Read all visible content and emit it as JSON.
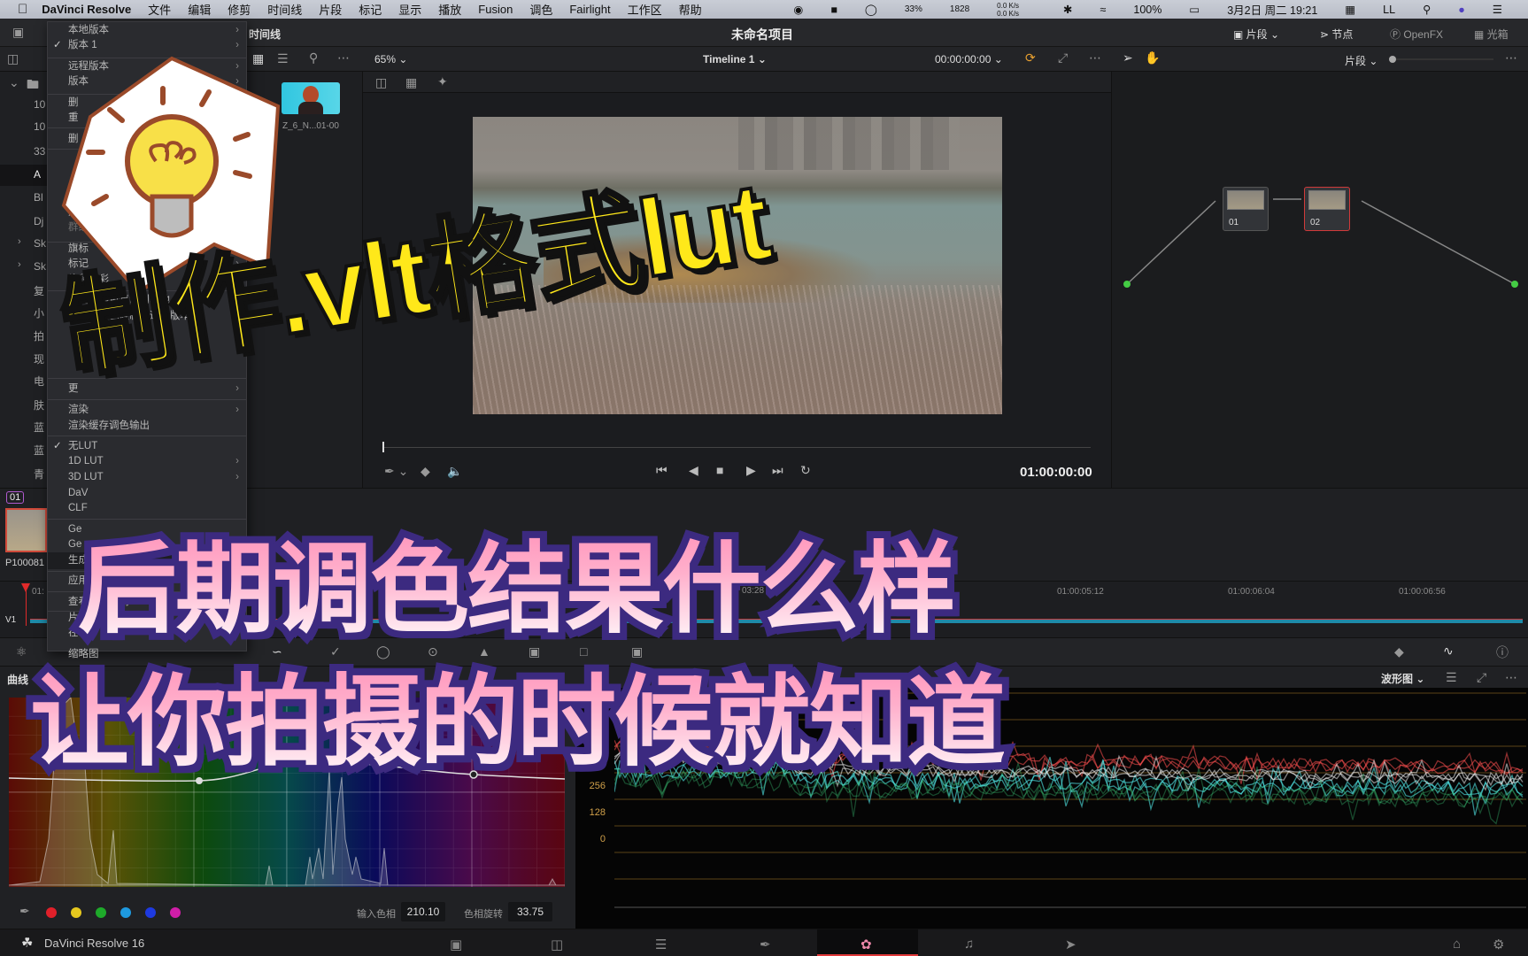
{
  "macbar": {
    "app": "DaVinci Resolve",
    "menus": [
      "文件",
      "编辑",
      "修剪",
      "时间线",
      "片段",
      "标记",
      "显示",
      "播放",
      "Fusion",
      "调色",
      "Fairlight",
      "工作区",
      "帮助"
    ],
    "status": {
      "cpu": "33%",
      "rpm": "1828",
      "net_up": "0.0 K/s",
      "net_down": "0.0 K/s",
      "battery": "100%",
      "datetime": "3月2日 周二 19:21",
      "user": "LL"
    }
  },
  "titlebar": {
    "project_title": "未命名项目",
    "left_label": "时间线",
    "buttons": [
      "片段",
      "节点",
      "OpenFX",
      "光箱"
    ]
  },
  "toolbar": {
    "zoom": "65%",
    "timeline": "Timeline 1",
    "timecode": "00:00:00:00",
    "node_mode": "片段"
  },
  "media_pool": {
    "bins": [
      "10",
      "10",
      "33",
      "A",
      "Bl",
      "Dj",
      "Sk",
      "Sk",
      "复",
      "小",
      "拍",
      "现",
      "电",
      "肤",
      "蓝",
      "蓝",
      "青"
    ],
    "selected_index": 3
  },
  "gallery": {
    "still_label": "Z_6_N...01-00"
  },
  "context_menu": {
    "items": [
      {
        "label": "本地版本",
        "submenu": true
      },
      {
        "label": "版本 1",
        "checked": true,
        "submenu": true
      },
      {
        "label": "远程版本",
        "submenu": true
      },
      {
        "label": "版本",
        "submenu": true
      },
      {
        "label": "删"
      },
      {
        "label": "重"
      },
      {
        "label": "删"
      },
      {
        "label": "从"
      },
      {
        "label": "群组",
        "disabled": true
      },
      {
        "label": "旗标",
        "submenu": true
      },
      {
        "label": "标记",
        "submenu": true
      },
      {
        "label": "片段色彩",
        "submenu": true
      },
      {
        "label": "将远程调色复制到本地"
      },
      {
        "label": "将本地调色复制到远程版本"
      },
      {
        "label": "更",
        "submenu": true
      },
      {
        "label": "渲染",
        "submenu": true
      },
      {
        "label": "渲染缓存调色输出"
      },
      {
        "label": "无LUT",
        "checked": true
      },
      {
        "label": "1D LUT",
        "submenu": true
      },
      {
        "label": "3D LUT",
        "submenu": true
      },
      {
        "label": "DaV"
      },
      {
        "label": "CLF"
      },
      {
        "label": "Ge"
      },
      {
        "label": "Ge"
      },
      {
        "label": "生成3D LUT"
      },
      {
        "label": "应用高光黑斑修正..."
      },
      {
        "label": "查看片段详情"
      },
      {
        "label": "片"
      },
      {
        "label": "在"
      },
      {
        "label": "缩略图"
      }
    ]
  },
  "viewer": {
    "timecode": "01:00:00:00"
  },
  "nodes": [
    {
      "label": "01"
    },
    {
      "label": "02"
    }
  ],
  "clip_strip": {
    "clip_number": "01",
    "clip_name": "P100081"
  },
  "timeline": {
    "track": "V1",
    "ruler": [
      "01:",
      "03:28",
      "01:00:05:12",
      "01:00:06:04",
      "01:00:06:56"
    ]
  },
  "curves": {
    "title": "曲线",
    "input_hue_label": "输入色相",
    "input_hue": "210.10",
    "hue_rotate_label": "色相旋转",
    "hue_rotate": "33.75",
    "swatches": [
      "#e0202a",
      "#e6c81e",
      "#1eaa2a",
      "#1e9ae0",
      "#1e3ae0",
      "#d01ea8"
    ]
  },
  "scope": {
    "mode": "波形图",
    "labels": [
      "768",
      "640",
      "512",
      "384",
      "256",
      "128",
      "0"
    ]
  },
  "footer": {
    "app_version": "DaVinci Resolve 16",
    "active_page": "color"
  },
  "overlay": {
    "headline": "制作.vlt格式lut",
    "line1": "后期调色结果什么样",
    "line2": "让你拍摄的时候就知道"
  }
}
